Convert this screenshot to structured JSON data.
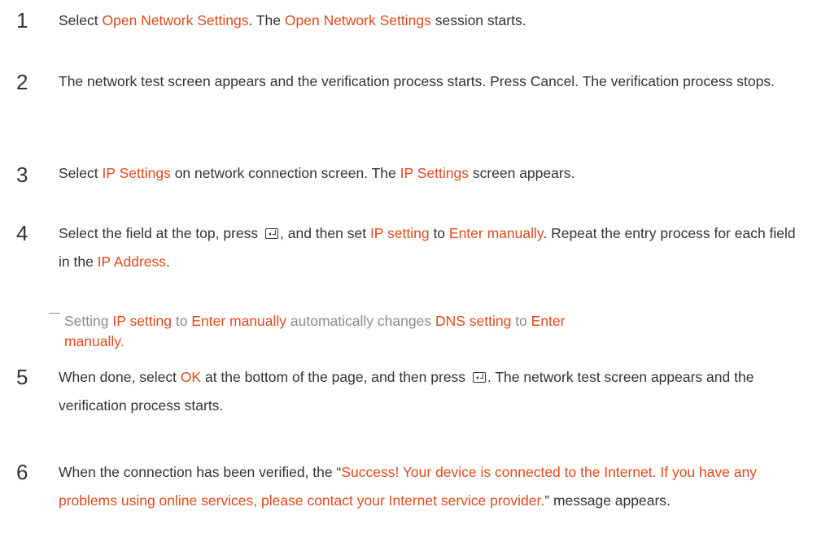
{
  "steps": [
    {
      "num": "1",
      "parts": [
        {
          "t": "Select "
        },
        {
          "t": "Open Network Settings",
          "hl": true
        },
        {
          "t": ". The "
        },
        {
          "t": "Open Network Settings",
          "hl": true
        },
        {
          "t": " session starts."
        }
      ]
    },
    {
      "num": "2",
      "parts": [
        {
          "t": "The network test screen appears and the verification process starts. Press Cancel. The verification process stops."
        }
      ]
    },
    {
      "num": "3",
      "parts": [
        {
          "t": "Select "
        },
        {
          "t": "IP Settings",
          "hl": true
        },
        {
          "t": " on network connection screen. The "
        },
        {
          "t": "IP Settings",
          "hl": true
        },
        {
          "t": " screen appears."
        }
      ]
    },
    {
      "num": "4",
      "parts": [
        {
          "t": "Select the field at the top, press "
        },
        {
          "icon": "enter-icon"
        },
        {
          "t": ", and then set "
        },
        {
          "t": "IP setting",
          "hl": true
        },
        {
          "t": " to "
        },
        {
          "t": "Enter manually",
          "hl": true
        },
        {
          "t": ". Repeat the entry process for each field in the "
        },
        {
          "t": "IP Address",
          "hl": true
        },
        {
          "t": "."
        }
      ]
    },
    {
      "num": "5",
      "parts": [
        {
          "t": "When done, select "
        },
        {
          "t": "OK",
          "hl": true
        },
        {
          "t": " at the bottom of the page, and then press "
        },
        {
          "icon": "enter-icon"
        },
        {
          "t": ". The network test screen appears and the verification process starts."
        }
      ]
    },
    {
      "num": "6",
      "parts": [
        {
          "t": "When the connection has been verified, the “"
        },
        {
          "t": "Success! Your device is connected to the Internet. If you have any problems using online services, please contact your Internet service provider.",
          "hl": true
        },
        {
          "t": "” message appears."
        }
      ]
    }
  ],
  "note": {
    "parts": [
      {
        "t": "Setting "
      },
      {
        "t": "IP setting",
        "hl": true
      },
      {
        "t": " to "
      },
      {
        "t": "Enter manually",
        "hl": true
      },
      {
        "t": " automatically changes "
      },
      {
        "t": "DNS setting",
        "hl": true
      },
      {
        "t": " to "
      },
      {
        "t": "Enter",
        "hl": true
      }
    ],
    "cont_parts": [
      {
        "t": "manually",
        "hl": true
      },
      {
        "t": "."
      }
    ]
  },
  "colors": {
    "highlight": "#e2491c",
    "text": "#333333",
    "note": "#8a8a8a"
  }
}
